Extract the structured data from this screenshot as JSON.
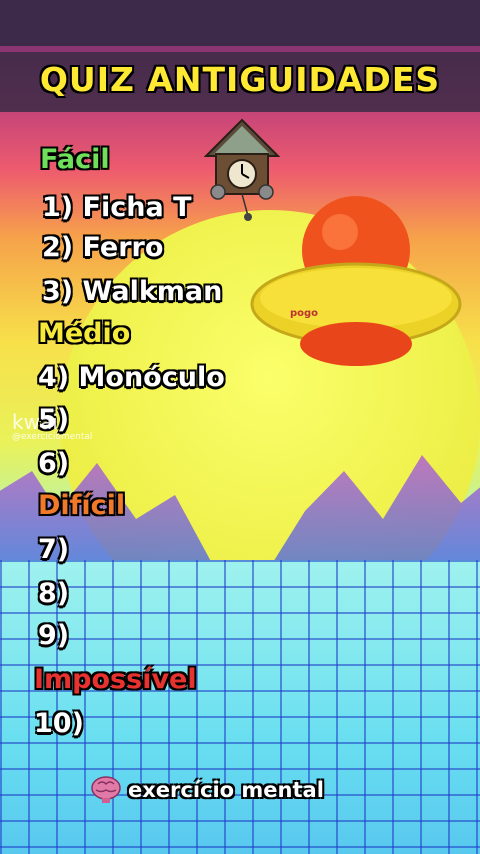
{
  "title": "QUIZ ANTIGUIDADES",
  "categories": {
    "easy": {
      "label": "Fácil",
      "color": "#6fe05a"
    },
    "medium": {
      "label": "Médio",
      "color": "#f5ea3a"
    },
    "hard": {
      "label": "Difícil",
      "color": "#f07a2a"
    },
    "impossible": {
      "label": "Impossível",
      "color": "#e8322f"
    }
  },
  "items": [
    "1) Ficha T",
    "2) Ferro",
    "3) Walkman",
    "4) Monóculo",
    "5)",
    "6)",
    "7)",
    "8)",
    "9)",
    "10)"
  ],
  "watermark": {
    "brand": "kwai",
    "handle": "@exerciciomental"
  },
  "footer": {
    "text": "exercício mental",
    "icon": "brain-icon"
  },
  "images": {
    "clock": "cuckoo-clock-icon",
    "toy": "pogo-ball-icon"
  }
}
